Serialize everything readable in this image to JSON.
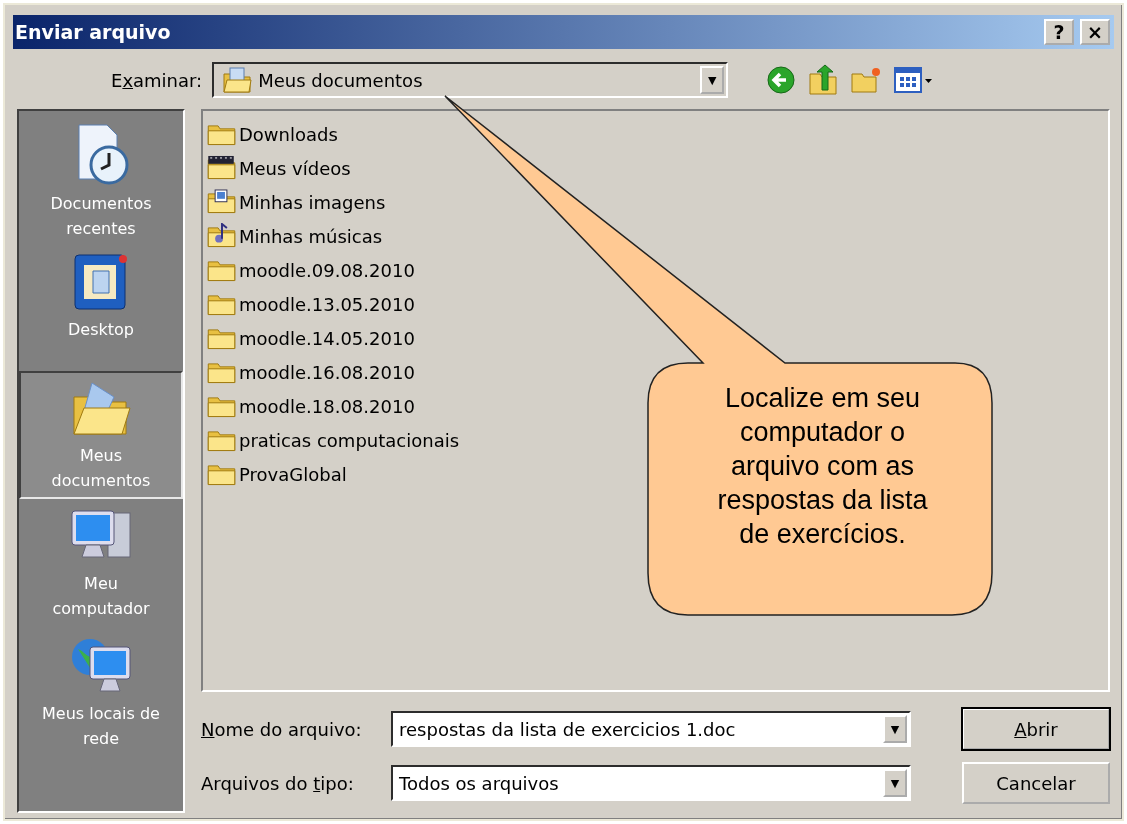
{
  "window": {
    "title": "Enviar arquivo",
    "buttons": [
      {
        "kind": "help",
        "label": "?"
      },
      {
        "kind": "close",
        "label": "×"
      }
    ]
  },
  "look_in": {
    "label_parts": [
      {
        "text": "E",
        "underlined": false
      },
      {
        "text": "x",
        "underlined": true
      },
      {
        "text": "aminar:",
        "underlined": false
      }
    ],
    "value": "Meus documentos",
    "arrow": "▼"
  },
  "places": [
    {
      "kind": "recent",
      "label": "Documentos recentes",
      "selected": false
    },
    {
      "kind": "desktop",
      "label": "Desktop",
      "selected": false
    },
    {
      "kind": "documents",
      "label": "Meus documentos",
      "selected": true
    },
    {
      "kind": "computer",
      "label": "Meu computador",
      "selected": false
    },
    {
      "kind": "network",
      "label": "Meus locais de rede",
      "selected": false
    }
  ],
  "files": [
    {
      "kind": "folder",
      "name": "Downloads"
    },
    {
      "kind": "videos",
      "name": "Meus vídeos"
    },
    {
      "kind": "pictures",
      "name": "Minhas imagens"
    },
    {
      "kind": "music",
      "name": "Minhas músicas"
    },
    {
      "kind": "folder",
      "name": "moodle.09.08.2010"
    },
    {
      "kind": "folder",
      "name": "moodle.13.05.2010"
    },
    {
      "kind": "folder",
      "name": "moodle.14.05.2010"
    },
    {
      "kind": "folder",
      "name": "moodle.16.08.2010"
    },
    {
      "kind": "folder",
      "name": "moodle.18.08.2010"
    },
    {
      "kind": "folder",
      "name": "praticas computacionais"
    },
    {
      "kind": "folder",
      "name": "ProvaGlobal"
    }
  ],
  "file_name": {
    "label_parts": [
      {
        "text": "N",
        "underlined": true
      },
      {
        "text": "ome do arquivo:",
        "underlined": false
      }
    ],
    "value": "respostas da lista de exercicios 1.doc",
    "arrow": "▼"
  },
  "file_type": {
    "label_parts": [
      {
        "text": "Arquivos do ",
        "underlined": false
      },
      {
        "text": "t",
        "underlined": true
      },
      {
        "text": "ipo:",
        "underlined": false
      }
    ],
    "value": "Todos os arquivos",
    "arrow": "▼"
  },
  "actions": [
    {
      "label_parts": [
        {
          "text": "A",
          "underlined": true
        },
        {
          "text": "brir",
          "underlined": false
        }
      ],
      "default": true
    },
    {
      "label_parts": [
        {
          "text": "Cancelar",
          "underlined": false
        }
      ],
      "default": false
    }
  ],
  "callout": {
    "text": "Localize em seu computador o arquivo com as respostas da lista de exercícios."
  }
}
